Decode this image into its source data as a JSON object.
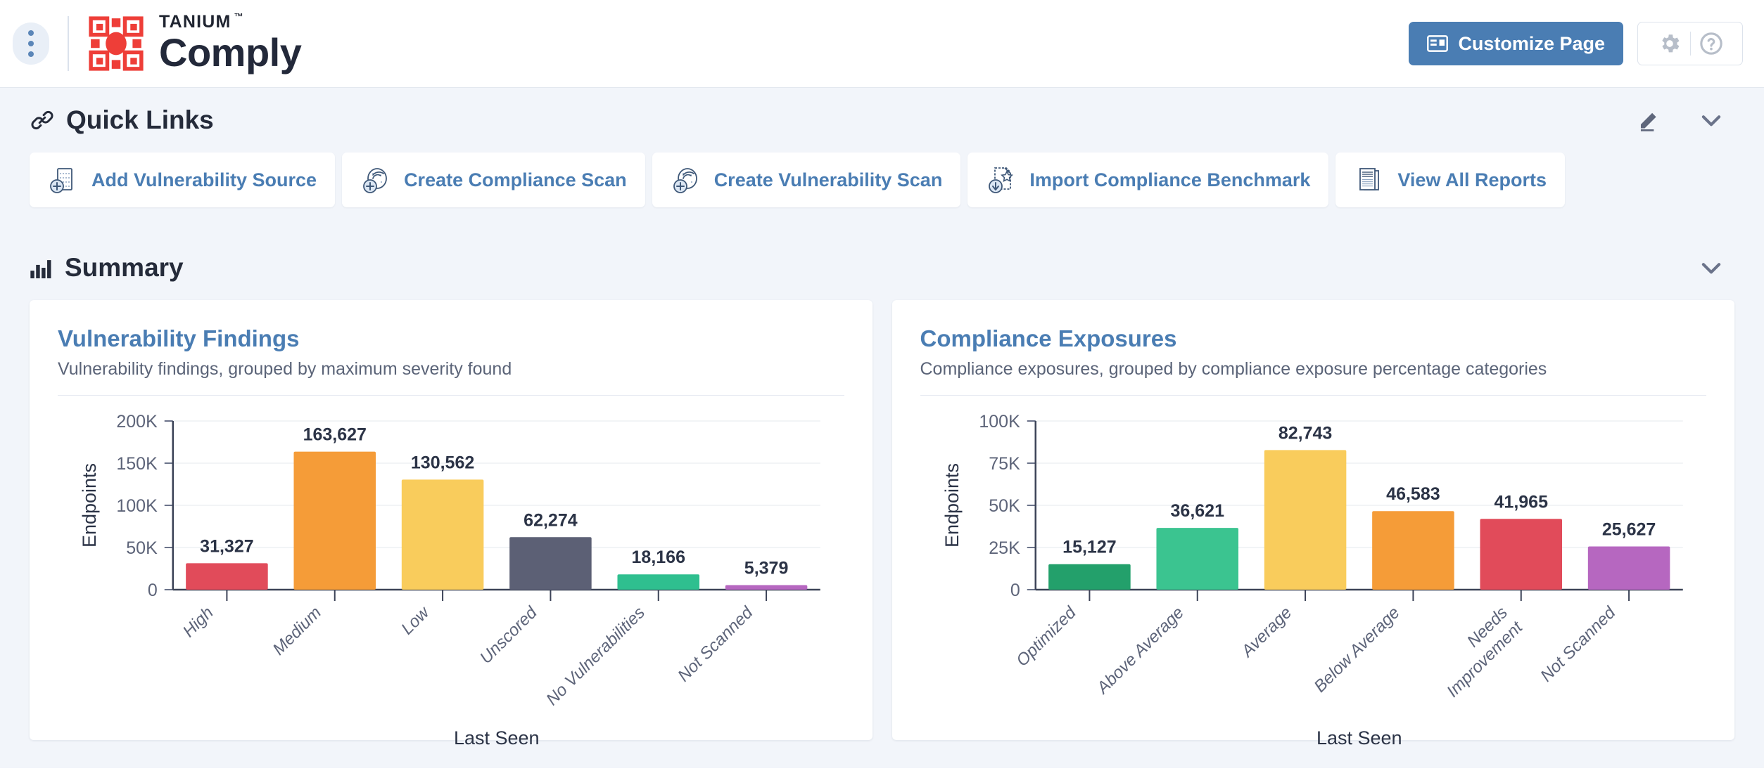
{
  "app": {
    "brand_name": "TANIUM",
    "brand_tm": "™",
    "product": "Comply",
    "logo_color": "#ee3e38",
    "accent_color": "#4a7db3"
  },
  "topbar": {
    "menu_icon": "kebab-menu-icon",
    "customize_label": "Customize Page",
    "customize_icon": "dashboard-layout-icon",
    "settings_icon": "gear-icon",
    "help_icon": "question-circle-icon"
  },
  "quick_links": {
    "title": "Quick Links",
    "icon": "chain-link-icon",
    "edit_icon": "pencil-icon",
    "collapse_icon": "chevron-down-icon",
    "items": [
      {
        "label": "Add Vulnerability Source",
        "icon": "add-source-icon"
      },
      {
        "label": "Create Compliance Scan",
        "icon": "create-compliance-scan-icon"
      },
      {
        "label": "Create Vulnerability Scan",
        "icon": "create-vulnerability-scan-icon"
      },
      {
        "label": "Import Compliance Benchmark",
        "icon": "import-benchmark-icon"
      },
      {
        "label": "View All Reports",
        "icon": "reports-icon"
      }
    ]
  },
  "summary": {
    "title": "Summary",
    "icon": "bar-chart-icon",
    "collapse_icon": "chevron-down-icon"
  },
  "chart_data": [
    {
      "type": "bar",
      "title": "Vulnerability Findings",
      "subtitle": "Vulnerability findings, grouped by maximum severity found",
      "categories": [
        "High",
        "Medium",
        "Low",
        "Unscored",
        "No Vulnerabilities",
        "Not Scanned"
      ],
      "values": [
        31327,
        163627,
        130562,
        62274,
        18166,
        5379
      ],
      "value_labels": [
        "31,327",
        "163,627",
        "130,562",
        "62,274",
        "18,166",
        "5,379"
      ],
      "colors": [
        "#e14b5a",
        "#f59c38",
        "#f9cc5c",
        "#5c6075",
        "#2fbf8f",
        "#b667c0"
      ],
      "xlabel": "Last Seen",
      "ylabel": "Endpoints",
      "ylim": [
        0,
        200000
      ],
      "yticks": [
        0,
        50000,
        100000,
        150000,
        200000
      ],
      "ytick_labels": [
        "0",
        "50K",
        "100K",
        "150K",
        "200K"
      ],
      "grid": true,
      "legend": "none"
    },
    {
      "type": "bar",
      "title": "Compliance Exposures",
      "subtitle": "Compliance exposures, grouped by compliance exposure percentage categories",
      "categories": [
        "Optimized",
        "Above Average",
        "Average",
        "Below Average",
        "Needs Improvement",
        "Not Scanned"
      ],
      "values": [
        15127,
        36621,
        82743,
        46583,
        41965,
        25627
      ],
      "value_labels": [
        "15,127",
        "36,621",
        "82,743",
        "46,583",
        "41,965",
        "25,627"
      ],
      "colors": [
        "#23a06b",
        "#3bc490",
        "#f9cc5c",
        "#f59c38",
        "#e14b5a",
        "#b667c0"
      ],
      "xlabel": "Last Seen",
      "ylabel": "Endpoints",
      "ylim": [
        0,
        100000
      ],
      "yticks": [
        0,
        25000,
        50000,
        75000,
        100000
      ],
      "ytick_labels": [
        "0",
        "25K",
        "50K",
        "75K",
        "100K"
      ],
      "grid": true,
      "legend": "none"
    }
  ]
}
